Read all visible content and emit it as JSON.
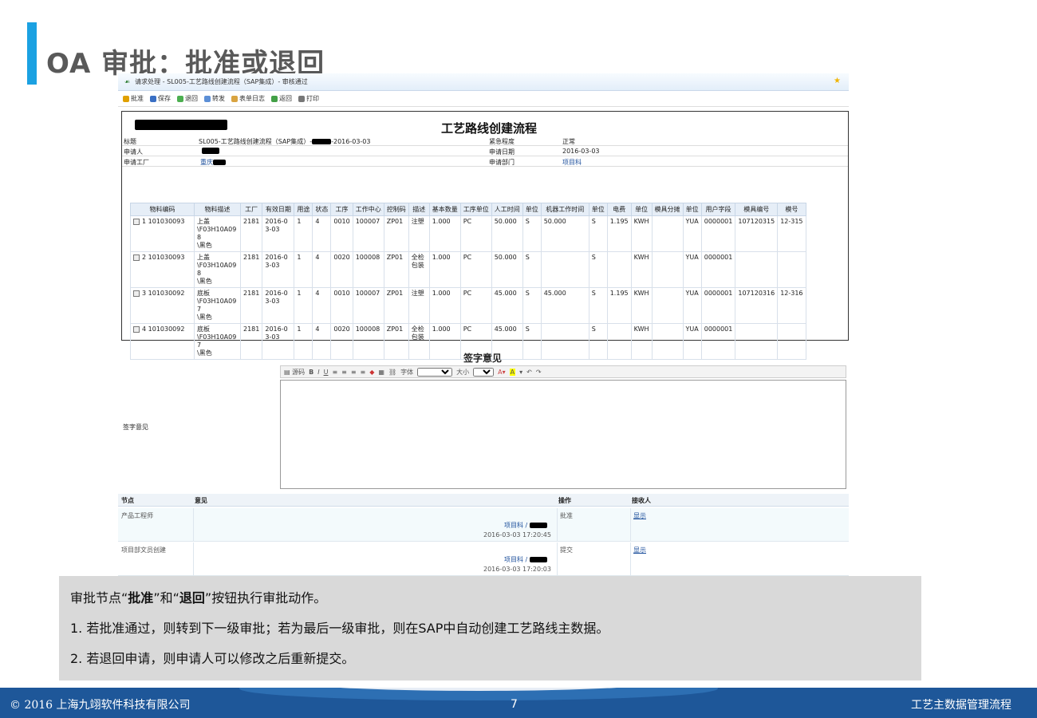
{
  "slide": {
    "title": "OA 审批：批准或退回",
    "accent_color": "#1ba1e2"
  },
  "window": {
    "title": "请求处理 - SL005-工艺路线创建流程（SAP集成）- 审核通过",
    "toolbar": [
      "批准",
      "保存",
      "退回",
      "转发",
      "表单日志",
      "返回",
      "打印"
    ]
  },
  "form": {
    "title": "工艺路线创建流程",
    "fields": {
      "subject_label": "标题",
      "subject_value_a": "SL005-工艺路线创建流程（SAP集成）-",
      "subject_value_b": "-2016-03-03",
      "urgency_label": "紧急程度",
      "urgency_value": "正常",
      "applicant_label": "申请人",
      "apply_date_label": "申请日期",
      "apply_date_value": "2016-03-03",
      "plant_label": "申请工厂",
      "plant_value": "重庆",
      "dept_label": "申请部门",
      "dept_value": "项目科"
    },
    "columns": [
      "物料编码",
      "物料描述",
      "工厂",
      "有效日期",
      "用途",
      "状态",
      "工序",
      "工作中心",
      "控制码",
      "描述",
      "基本数量",
      "工序单位",
      "人工时间",
      "单位",
      "机器工作时间",
      "单位",
      "电费",
      "单位",
      "模具分摊",
      "单位",
      "用户字段",
      "模具编号",
      "模号"
    ],
    "rows": [
      [
        "1  101030093",
        "上盖\\F03H10A098\\黑色",
        "2181",
        "2016-03-03",
        "1",
        "4",
        "0010",
        "100007",
        "ZP01",
        "注塑",
        "1.000",
        "PC",
        "50.000",
        "S",
        "50.000",
        "S",
        "1.195",
        "KWH",
        "",
        "YUA",
        "0000001",
        "107120315",
        "12-315"
      ],
      [
        "2  101030093",
        "上盖\\F03H10A098\\黑色",
        "2181",
        "2016-03-03",
        "1",
        "4",
        "0020",
        "100008",
        "ZP01",
        "全检包装",
        "1.000",
        "PC",
        "50.000",
        "S",
        "",
        "S",
        "",
        "KWH",
        "",
        "YUA",
        "0000001",
        "",
        ""
      ],
      [
        "3  101030092",
        "底板\\F03H10A097\\黑色",
        "2181",
        "2016-03-03",
        "1",
        "4",
        "0010",
        "100007",
        "ZP01",
        "注塑",
        "1.000",
        "PC",
        "45.000",
        "S",
        "45.000",
        "S",
        "1.195",
        "KWH",
        "",
        "YUA",
        "0000001",
        "107120316",
        "12-316"
      ],
      [
        "4  101030092",
        "底板\\F03H10A097\\黑色",
        "2181",
        "2016-03-03",
        "1",
        "4",
        "0020",
        "100008",
        "ZP01",
        "全检包装",
        "1.000",
        "PC",
        "45.000",
        "S",
        "",
        "S",
        "",
        "KWH",
        "",
        "YUA",
        "0000001",
        "",
        ""
      ]
    ]
  },
  "signature": {
    "heading": "签字意见",
    "left_label": "签字意见",
    "toolbar": {
      "source": "源码",
      "font_label": "字体",
      "size_label": "大小"
    }
  },
  "log": {
    "headers": [
      "节点",
      "意见",
      "操作",
      "接收人"
    ],
    "rows": [
      {
        "node": "产品工程师",
        "dept": "项目科 /",
        "time": "2016-03-03  17:20:45",
        "action": "批准",
        "receiver": "显示"
      },
      {
        "node": "项目部文员创建",
        "dept": "项目科 /",
        "time": "2016-03-03  17:20:03",
        "action": "提交",
        "receiver": "显示"
      }
    ]
  },
  "caption": {
    "line1_a": "审批节点“",
    "line1_b": "批准",
    "line1_c": "”和“",
    "line1_d": "退回",
    "line1_e": "”按钮执行审批动作。",
    "line2": "1.  若批准通过，则转到下一级审批；若为最后一级审批，则在SAP中自动创建工艺路线主数据。",
    "line3": "2.  若退回申请，则申请人可以修改之后重新提交。"
  },
  "footer": {
    "copyright": "© 2016 上海九翊软件科技有限公司",
    "page": "7",
    "section": "工艺主数据管理流程"
  }
}
